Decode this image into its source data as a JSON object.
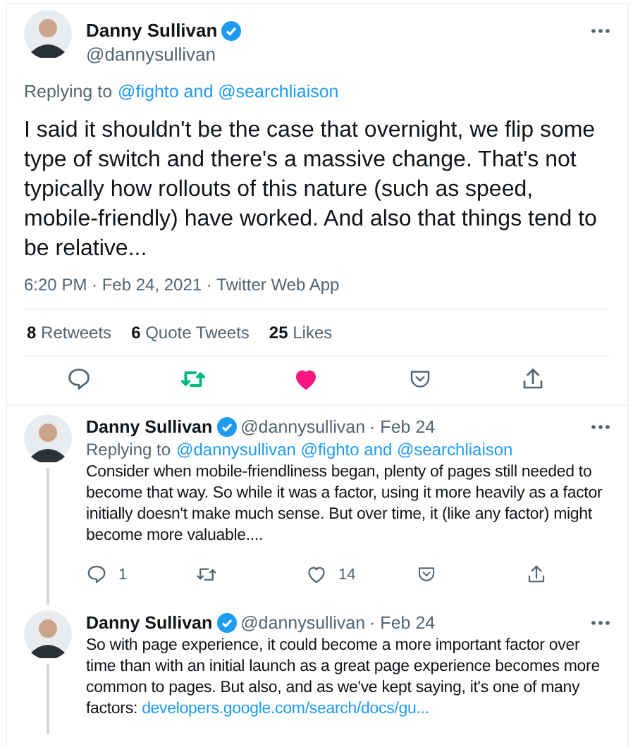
{
  "main_tweet": {
    "name": "Danny Sullivan",
    "verified": true,
    "handle": "@dannysullivan",
    "replying_prefix": "Replying to",
    "replying_to": "@fighto and @searchliaison",
    "text": "I said it shouldn't be the case that overnight, we flip some type of switch and there's a massive change. That's not typically how rollouts of this nature (such as speed, mobile-friendly) have worked. And also that things tend to be relative...",
    "meta": "6:20 PM · Feb 24, 2021 · Twitter Web App",
    "stats": [
      {
        "count": "8",
        "label": "Retweets"
      },
      {
        "count": "6",
        "label": "Quote Tweets"
      },
      {
        "count": "25",
        "label": "Likes"
      }
    ],
    "actions": [
      {
        "kind": "reply",
        "on": false
      },
      {
        "kind": "retweet",
        "on": true
      },
      {
        "kind": "like",
        "on": true
      },
      {
        "kind": "bookmark",
        "on": false
      },
      {
        "kind": "share",
        "on": false
      }
    ]
  },
  "replies": [
    {
      "name": "Danny Sullivan",
      "verified": true,
      "handle": "@dannysullivan",
      "date": "· Feb 24",
      "replying_prefix": "Replying to",
      "replying_to": "@dannysullivan @fighto and @searchliaison",
      "text": "Consider when mobile-friendliness began, plenty of pages still needed to become that way. So while it was a factor, using it more heavily as a factor initially doesn't make much sense. But over time, it (like any factor) might become more valuable....",
      "actions": [
        {
          "kind": "reply",
          "on": false,
          "count": "1"
        },
        {
          "kind": "retweet",
          "on": false
        },
        {
          "kind": "like",
          "on": false,
          "count": "14"
        },
        {
          "kind": "bookmark",
          "on": false
        },
        {
          "kind": "share",
          "on": false
        }
      ]
    },
    {
      "name": "Danny Sullivan",
      "verified": true,
      "handle": "@dannysullivan",
      "date": "· Feb 24",
      "text": "So with page experience, it could become a more important factor over time than with an initial launch as a great page experience becomes more common to pages. But also, and as we've kept saying, it's one of many factors:",
      "link": "developers.google.com/search/docs/gu..."
    }
  ]
}
